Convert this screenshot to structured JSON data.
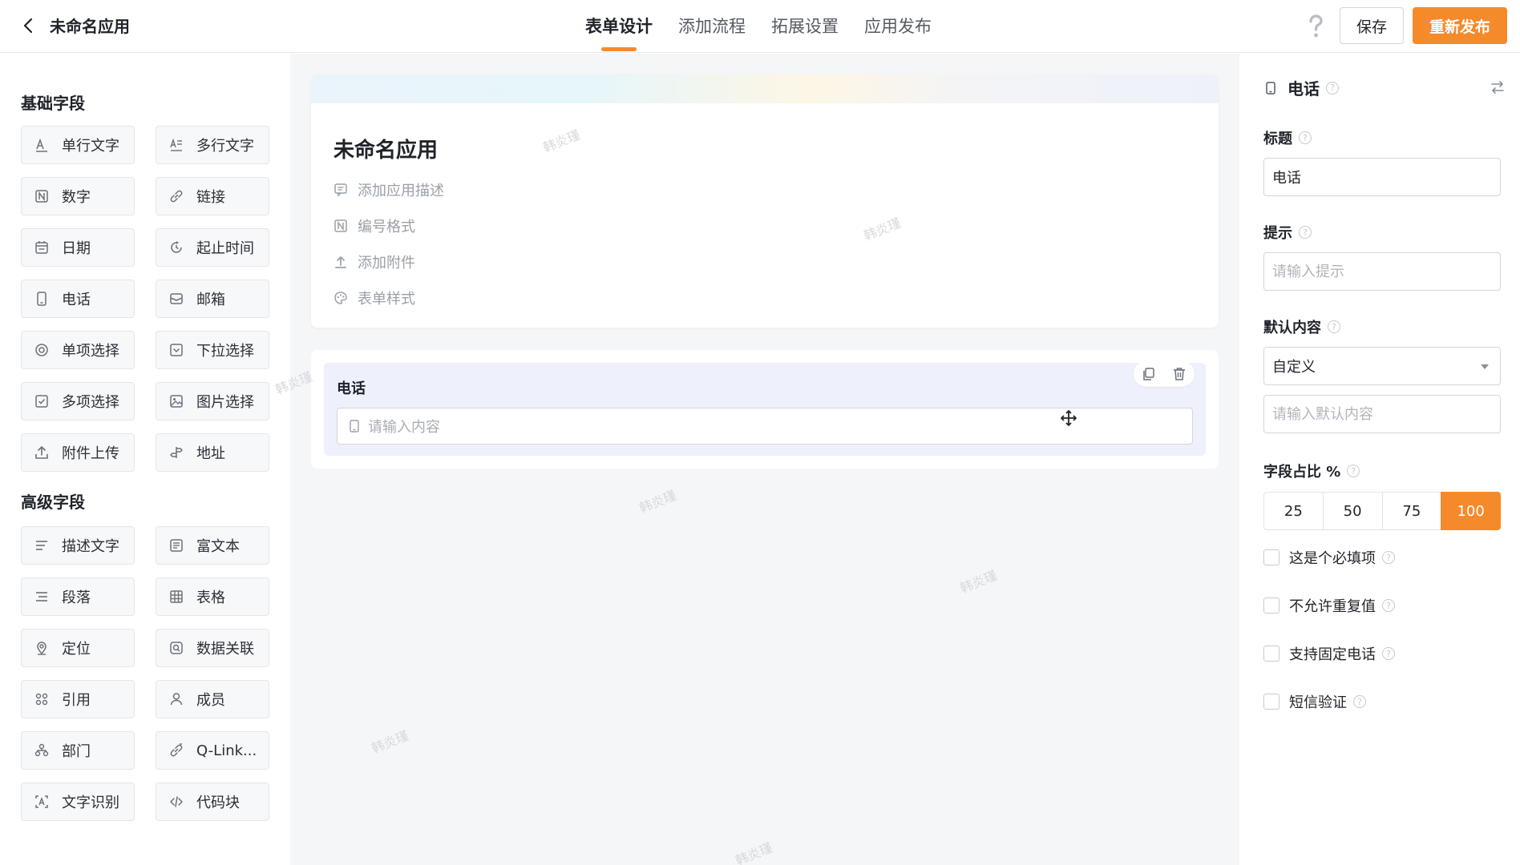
{
  "header": {
    "app_title": "未命名应用",
    "tabs": [
      "表单设计",
      "添加流程",
      "拓展设置",
      "应用发布"
    ],
    "active_tab": "表单设计",
    "save_label": "保存",
    "publish_label": "重新发布",
    "accent_color": "#f58a2b"
  },
  "left_panel": {
    "basic_title": "基础字段",
    "basic_fields": [
      {
        "label": "单行文字",
        "icon": "text-line-icon"
      },
      {
        "label": "多行文字",
        "icon": "text-multiline-icon"
      },
      {
        "label": "数字",
        "icon": "number-icon"
      },
      {
        "label": "链接",
        "icon": "link-icon"
      },
      {
        "label": "日期",
        "icon": "calendar-icon"
      },
      {
        "label": "起止时间",
        "icon": "time-range-icon"
      },
      {
        "label": "电话",
        "icon": "phone-icon"
      },
      {
        "label": "邮箱",
        "icon": "mail-icon"
      },
      {
        "label": "单项选择",
        "icon": "radio-icon"
      },
      {
        "label": "下拉选择",
        "icon": "dropdown-icon"
      },
      {
        "label": "多项选择",
        "icon": "checkbox-icon"
      },
      {
        "label": "图片选择",
        "icon": "image-icon"
      },
      {
        "label": "附件上传",
        "icon": "upload-icon"
      },
      {
        "label": "地址",
        "icon": "address-icon"
      }
    ],
    "advanced_title": "高级字段",
    "advanced_fields": [
      {
        "label": "描述文字",
        "icon": "description-icon"
      },
      {
        "label": "富文本",
        "icon": "rich-text-icon"
      },
      {
        "label": "段落",
        "icon": "paragraph-icon"
      },
      {
        "label": "表格",
        "icon": "table-icon"
      },
      {
        "label": "定位",
        "icon": "location-icon"
      },
      {
        "label": "数据关联",
        "icon": "data-link-icon"
      },
      {
        "label": "引用",
        "icon": "reference-icon"
      },
      {
        "label": "成员",
        "icon": "member-icon"
      },
      {
        "label": "部门",
        "icon": "department-icon"
      },
      {
        "label": "Q-Link...",
        "icon": "q-link-icon"
      },
      {
        "label": "文字识别",
        "icon": "ocr-icon"
      },
      {
        "label": "代码块",
        "icon": "code-icon"
      }
    ]
  },
  "canvas": {
    "form_title": "未命名应用",
    "header_links": [
      {
        "label": "添加应用描述",
        "icon": "comment-icon"
      },
      {
        "label": "编号格式",
        "icon": "number-format-icon"
      },
      {
        "label": "添加附件",
        "icon": "attachment-upload-icon"
      },
      {
        "label": "表单样式",
        "icon": "palette-icon"
      }
    ],
    "field": {
      "label": "电话",
      "placeholder": "请输入内容"
    },
    "watermark_text": "韩炎瑾"
  },
  "right_panel": {
    "field_type": "电话",
    "title_label": "标题",
    "title_value": "电话",
    "hint_label": "提示",
    "hint_placeholder": "请输入提示",
    "default_label": "默认内容",
    "default_select": "自定义",
    "default_placeholder": "请输入默认内容",
    "width_label": "字段占比 %",
    "width_options": [
      "25",
      "50",
      "75",
      "100"
    ],
    "width_selected": "100",
    "checkboxes": [
      "这是个必填项",
      "不允许重复值",
      "支持固定电话",
      "短信验证"
    ]
  }
}
